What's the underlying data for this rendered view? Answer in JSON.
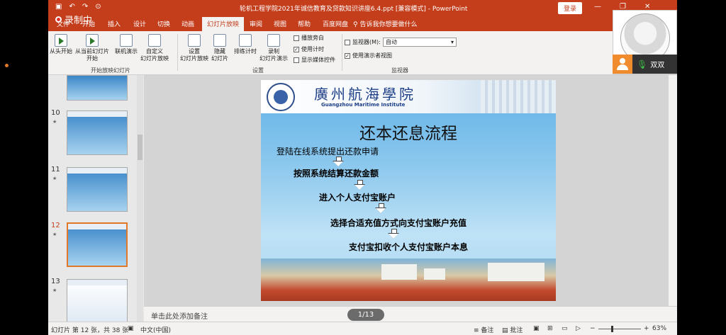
{
  "titlebar": {
    "quick_access": [
      "▣",
      "↶",
      "↷",
      "⊙"
    ],
    "document_title": "轮机工程学院2021年诚信教育及贷款知识讲座6.4.ppt [兼容模式] - PowerPoint",
    "login": "登录",
    "window_controls": [
      "—",
      "❐",
      "✕"
    ]
  },
  "recording": {
    "label": "录制中"
  },
  "tabs": [
    {
      "label": "文件"
    },
    {
      "label": "开始"
    },
    {
      "label": "插入"
    },
    {
      "label": "设计"
    },
    {
      "label": "切换"
    },
    {
      "label": "动画"
    },
    {
      "label": "幻灯片放映"
    },
    {
      "label": "审阅"
    },
    {
      "label": "视图"
    },
    {
      "label": "帮助"
    },
    {
      "label": "百度网盘"
    }
  ],
  "tell_me": "告诉我你想要做什么",
  "ribbon": {
    "from_beginning": "从头开始",
    "from_current": "从当前幻灯片",
    "from_current_2": "开始",
    "online": "联机演示",
    "custom": "自定义",
    "custom_2": "幻灯片放映",
    "group_start": "开始放映幻灯片",
    "setup": "设置",
    "setup_2": "幻灯片放映",
    "hide": "隐藏",
    "hide_2": "幻灯片",
    "rehearse": "排练计时",
    "record": "录制",
    "record_2": "幻灯片演示",
    "chk_narration": "播放旁白",
    "chk_timing": "使用计时",
    "chk_media": "显示媒体控件",
    "group_setup": "设置",
    "monitor_label": "监视器(M):",
    "monitor_value": "自动",
    "presenter_view": "使用演示者视图",
    "group_monitor": "监视器"
  },
  "thumbnails": [
    {
      "num": "10"
    },
    {
      "num": "11"
    },
    {
      "num": "12"
    },
    {
      "num": "13"
    }
  ],
  "slide": {
    "school_cn": "廣州航海學院",
    "school_en": "Guangzhou Maritime Institute",
    "title": "还本还息流程",
    "steps": [
      "登陆在线系统提出还款申请",
      "按照系统结算还款金额",
      "进入个人支付宝账户",
      "选择合适充值方式向支付宝账户充值",
      "支付宝扣收个人支付宝账户本息"
    ]
  },
  "notes_placeholder": "单击此处添加备注",
  "page_indicator": "1/13",
  "status": {
    "slide_info": "幻灯片 第 12 张，共 38 张",
    "language": "中文(中国)",
    "notes": "备注",
    "comments": "批注",
    "zoom": "63%",
    "zoom_level": 0.63
  },
  "meeting": {
    "name": "双双"
  }
}
